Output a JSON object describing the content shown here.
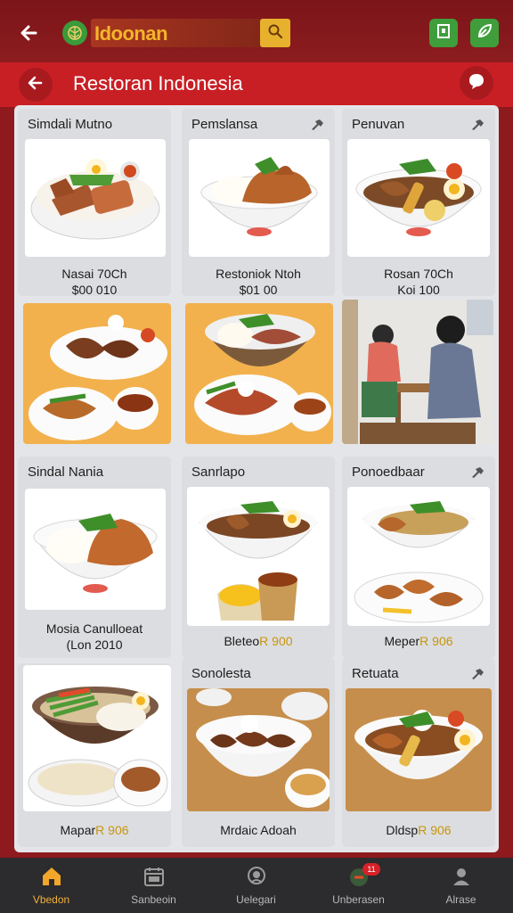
{
  "app": {
    "brand": "Idoonan",
    "colors": {
      "primary": "#c81f25",
      "dark": "#8e1a1e",
      "accent": "#e7b12e",
      "green": "#3f9e3b",
      "nav_bg": "#2c2b2d"
    }
  },
  "topbar": {
    "back_icon": "back-arrow-icon",
    "logo_icon": "leaf-logo-icon",
    "search_icon": "search-icon",
    "action_icons": [
      "frame-icon",
      "leaf-icon"
    ]
  },
  "page_header": {
    "title": "Restoran Indonesia",
    "back_icon": "back-arrow-icon",
    "action_icon": "chat-bubble-icon"
  },
  "cards": [
    {
      "title": "Simdali Mutno",
      "caption_1": "Nasai 70Ch",
      "caption_2": "$00 010"
    },
    {
      "title": "Pemslansa",
      "caption_1": "Restoniok Ntoh",
      "caption_2": "$01 00",
      "pin": true
    },
    {
      "title": "Penuvan",
      "caption_1": "Rosan 70Ch",
      "caption_2": "Koi 100",
      "pin": true
    },
    {
      "title": "Sindal Nania",
      "caption_1": "Mosia Canulloeat",
      "caption_2": "(Lon 2010"
    },
    {
      "title": "Sanrlapo",
      "caption_1": "Bleteo",
      "caption_1_gold": "R 900"
    },
    {
      "title": "Ponoedbaar",
      "caption_1": "Meper",
      "caption_1_gold": "R 906",
      "pin": true
    },
    {
      "title": "",
      "caption_1": "Mapar",
      "caption_1_gold": "R 906"
    },
    {
      "title": "Sonolesta",
      "caption_1": "Mrdaic Adoah"
    },
    {
      "title": "Retuata",
      "caption_1": "Dldsp",
      "caption_1_gold": "R 906",
      "pin": true
    }
  ],
  "nav": {
    "items": [
      {
        "label": "Vbedon",
        "icon": "home-icon"
      },
      {
        "label": "Sanbeoin",
        "icon": "calendar-icon"
      },
      {
        "label": "Uelegari",
        "icon": "chef-icon"
      },
      {
        "label": "Unberasen",
        "icon": "notification-icon",
        "badge": "11"
      },
      {
        "label": "Alrase",
        "icon": "profile-icon"
      }
    ]
  }
}
